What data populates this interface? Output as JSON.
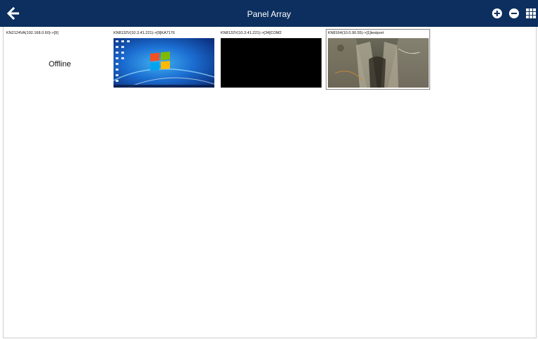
{
  "header": {
    "title": "Panel Array",
    "back_icon": "arrow-left-icon",
    "actions": [
      {
        "icon": "plus-circle-icon"
      },
      {
        "icon": "minus-circle-icon"
      },
      {
        "icon": "grid-icon"
      }
    ],
    "background_color": "#0c2f5f"
  },
  "panels": [
    {
      "label": "KN2124VA(192.168.0.60)->[9]",
      "status": "Offline",
      "preview": "none"
    },
    {
      "label": "KN8132V(10.3.41.221)->[9]KA7176",
      "preview": "windows-7-desktop"
    },
    {
      "label": "KN8132V(10.3.41.221)->[34]COM2",
      "preview": "black-screen"
    },
    {
      "label": "KN8164(10.0.90.55)->[1]testport",
      "preview": "camera-view",
      "selected": true
    }
  ]
}
